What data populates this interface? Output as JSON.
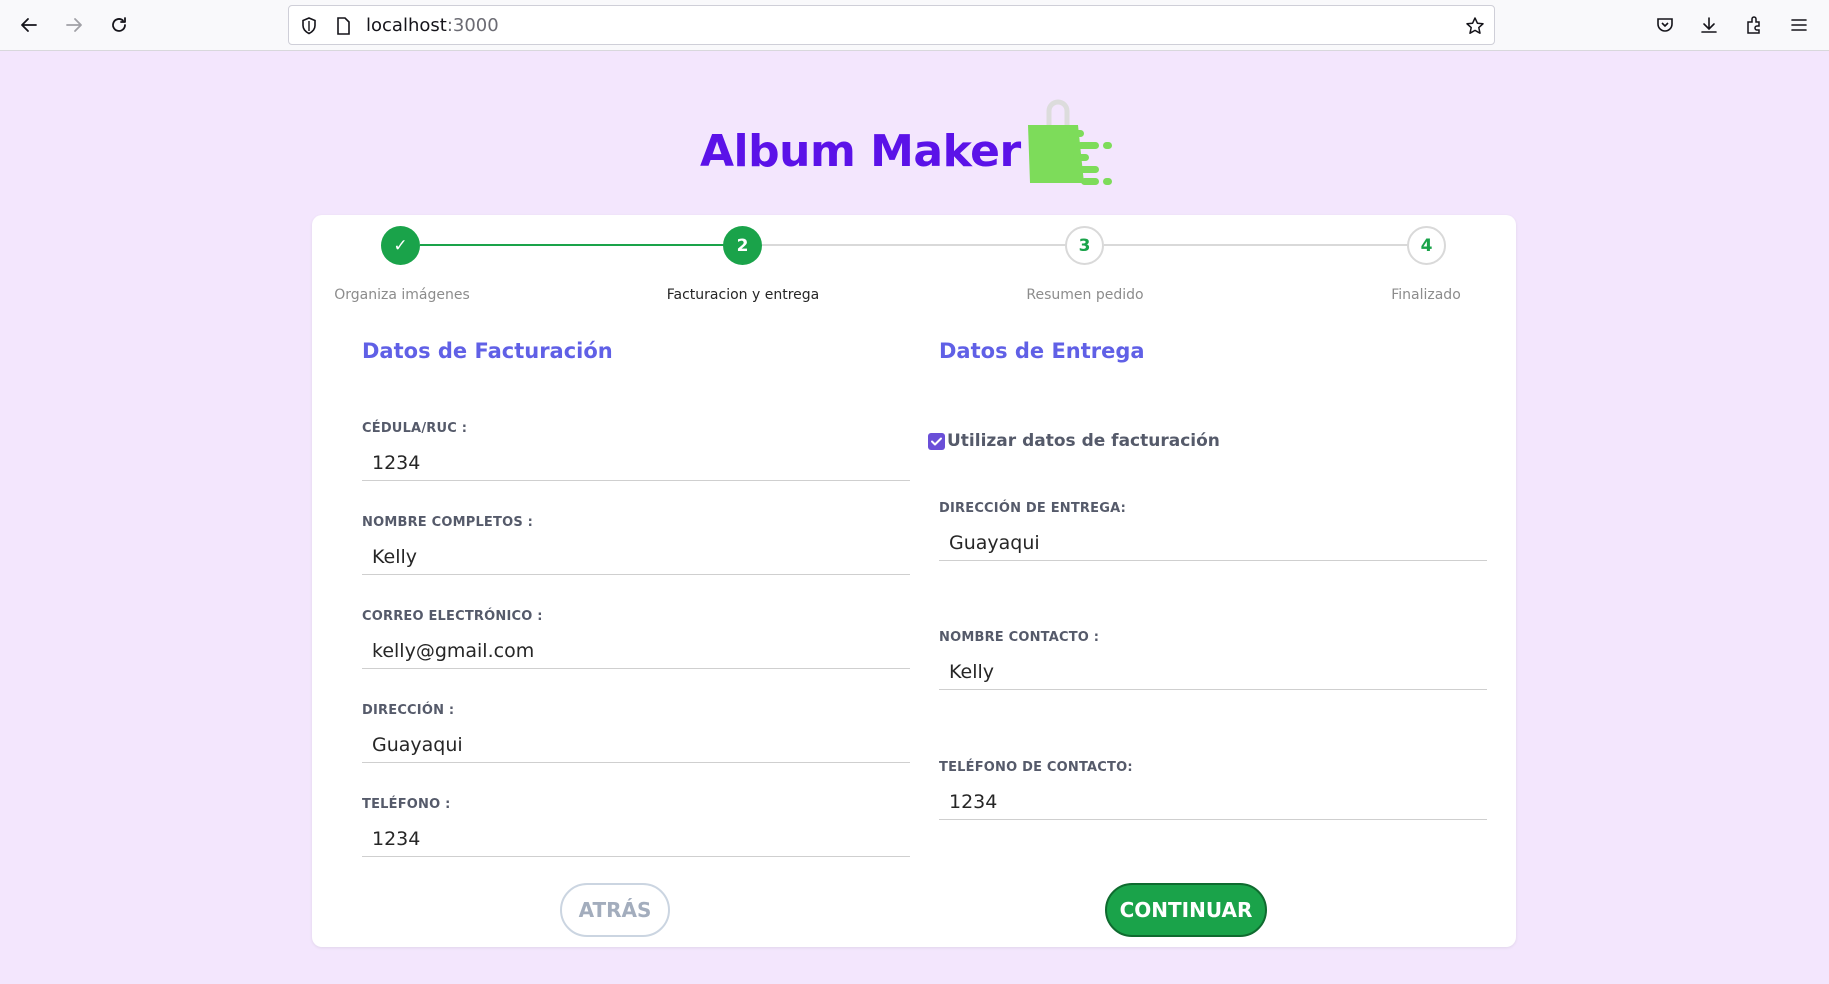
{
  "browser": {
    "url_host": "localhost",
    "url_port": ":3000"
  },
  "logo": {
    "title": "Album Maker"
  },
  "stepper": {
    "steps": [
      {
        "label": "Organiza imágenes",
        "marker": "✓",
        "state": "done"
      },
      {
        "label": "Facturacion y entrega",
        "marker": "2",
        "state": "current"
      },
      {
        "label": "Resumen pedido",
        "marker": "3",
        "state": "pending"
      },
      {
        "label": "Finalizado",
        "marker": "4",
        "state": "pending"
      }
    ]
  },
  "billing": {
    "title": "Datos de Facturación",
    "fields": [
      {
        "label": "CÉDULA/RUC :",
        "value": "1234"
      },
      {
        "label": "NOMBRE COMPLETOS :",
        "value": "Kelly"
      },
      {
        "label": "CORREO ELECTRÓNICO :",
        "value": "kelly@gmail.com"
      },
      {
        "label": "DIRECCIÓN :",
        "value": "Guayaqui"
      },
      {
        "label": "TELÉFONO :",
        "value": "1234"
      }
    ]
  },
  "delivery": {
    "title": "Datos de Entrega",
    "use_billing_label": "Utilizar datos de facturación",
    "use_billing_checked": true,
    "fields": [
      {
        "label": "DIRECCIÓN DE ENTREGA:",
        "value": "Guayaqui"
      },
      {
        "label": "NOMBRE CONTACTO :",
        "value": "Kelly"
      },
      {
        "label": "TELÉFONO DE CONTACTO:",
        "value": "1234"
      }
    ]
  },
  "actions": {
    "back_label": "ATRÁS",
    "continue_label": "CONTINUAR"
  },
  "colors": {
    "accent_green": "#1aa34a",
    "title_purple": "#5b12e8",
    "section_blue": "#6060e6",
    "background": "#f3e6fd"
  }
}
